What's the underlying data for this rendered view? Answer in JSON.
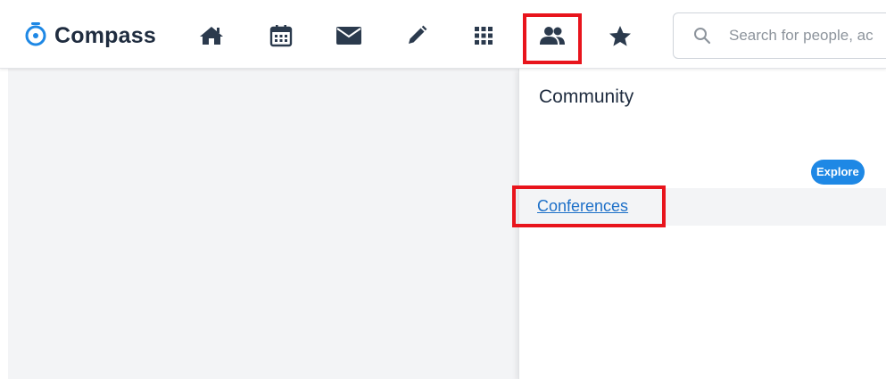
{
  "header": {
    "brand_name": "Compass",
    "nav_items": [
      {
        "icon": "home-icon"
      },
      {
        "icon": "calendar-icon"
      },
      {
        "icon": "mail-icon"
      },
      {
        "icon": "pencil-icon"
      },
      {
        "icon": "apps-grid-icon"
      },
      {
        "icon": "people-icon",
        "active": true
      },
      {
        "icon": "star-icon"
      }
    ],
    "search": {
      "placeholder": "Search for people, ac",
      "value": ""
    }
  },
  "dropdown": {
    "title": "Community",
    "badge_label": "Explore",
    "items": [
      {
        "label": "Conferences"
      }
    ]
  },
  "colors": {
    "brand_blue": "#1e88e5",
    "highlight_red": "#e8141c",
    "icon_dark": "#2b3a4d",
    "link_blue": "#1e70c8"
  }
}
